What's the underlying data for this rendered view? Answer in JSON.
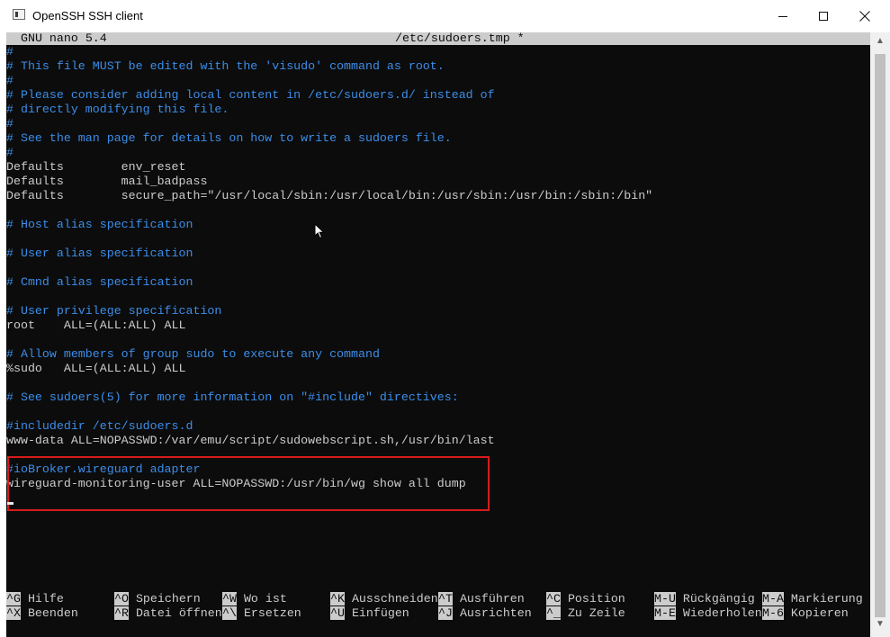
{
  "window": {
    "title": "OpenSSH SSH client",
    "icon": "terminal-app-icon",
    "controls": [
      "minimize-icon",
      "maximize-icon",
      "close-icon"
    ]
  },
  "nano": {
    "version": "GNU nano 5.4",
    "filename": "/etc/sudoers.tmp *"
  },
  "editor": {
    "lines": [
      "#",
      "# This file MUST be edited with the 'visudo' command as root.",
      "#",
      "# Please consider adding local content in /etc/sudoers.d/ instead of",
      "# directly modifying this file.",
      "#",
      "# See the man page for details on how to write a sudoers file.",
      "#",
      "Defaults        env_reset",
      "Defaults        mail_badpass",
      "Defaults        secure_path=\"/usr/local/sbin:/usr/local/bin:/usr/sbin:/usr/bin:/sbin:/bin\"",
      "",
      "# Host alias specification",
      "",
      "# User alias specification",
      "",
      "# Cmnd alias specification",
      "",
      "# User privilege specification",
      "root    ALL=(ALL:ALL) ALL",
      "",
      "# Allow members of group sudo to execute any command",
      "%sudo   ALL=(ALL:ALL) ALL",
      "",
      "# See sudoers(5) for more information on \"#include\" directives:",
      "",
      "#includedir /etc/sudoers.d",
      "www-data ALL=NOPASSWD:/var/emu/script/sudowebscript.sh,/usr/bin/last",
      "",
      "#ioBroker.wireguard adapter",
      "wireguard-monitoring-user ALL=NOPASSWD:/usr/bin/wg show all dump"
    ]
  },
  "shortcuts": {
    "row1": [
      {
        "key": "^G",
        "label": "Hilfe"
      },
      {
        "key": "^O",
        "label": "Speichern"
      },
      {
        "key": "^W",
        "label": "Wo ist"
      },
      {
        "key": "^K",
        "label": "Ausschneiden"
      },
      {
        "key": "^T",
        "label": "Ausführen"
      },
      {
        "key": "^C",
        "label": "Position"
      },
      {
        "key": "M-U",
        "label": "Rückgängig"
      },
      {
        "key": "M-A",
        "label": "Markierung"
      }
    ],
    "row2": [
      {
        "key": "^X",
        "label": "Beenden"
      },
      {
        "key": "^R",
        "label": "Datei öffnen"
      },
      {
        "key": "^\\",
        "label": "Ersetzen"
      },
      {
        "key": "^U",
        "label": "Einfügen"
      },
      {
        "key": "^J",
        "label": "Ausrichten"
      },
      {
        "key": "^_",
        "label": "Zu Zeile"
      },
      {
        "key": "M-E",
        "label": "Wiederholen"
      },
      {
        "key": "M-6",
        "label": "Kopieren"
      }
    ]
  },
  "colors": {
    "comment": "#3b8eea",
    "text": "#cccccc",
    "background": "#0c0c0c",
    "highlight_border": "#d81b1b"
  }
}
